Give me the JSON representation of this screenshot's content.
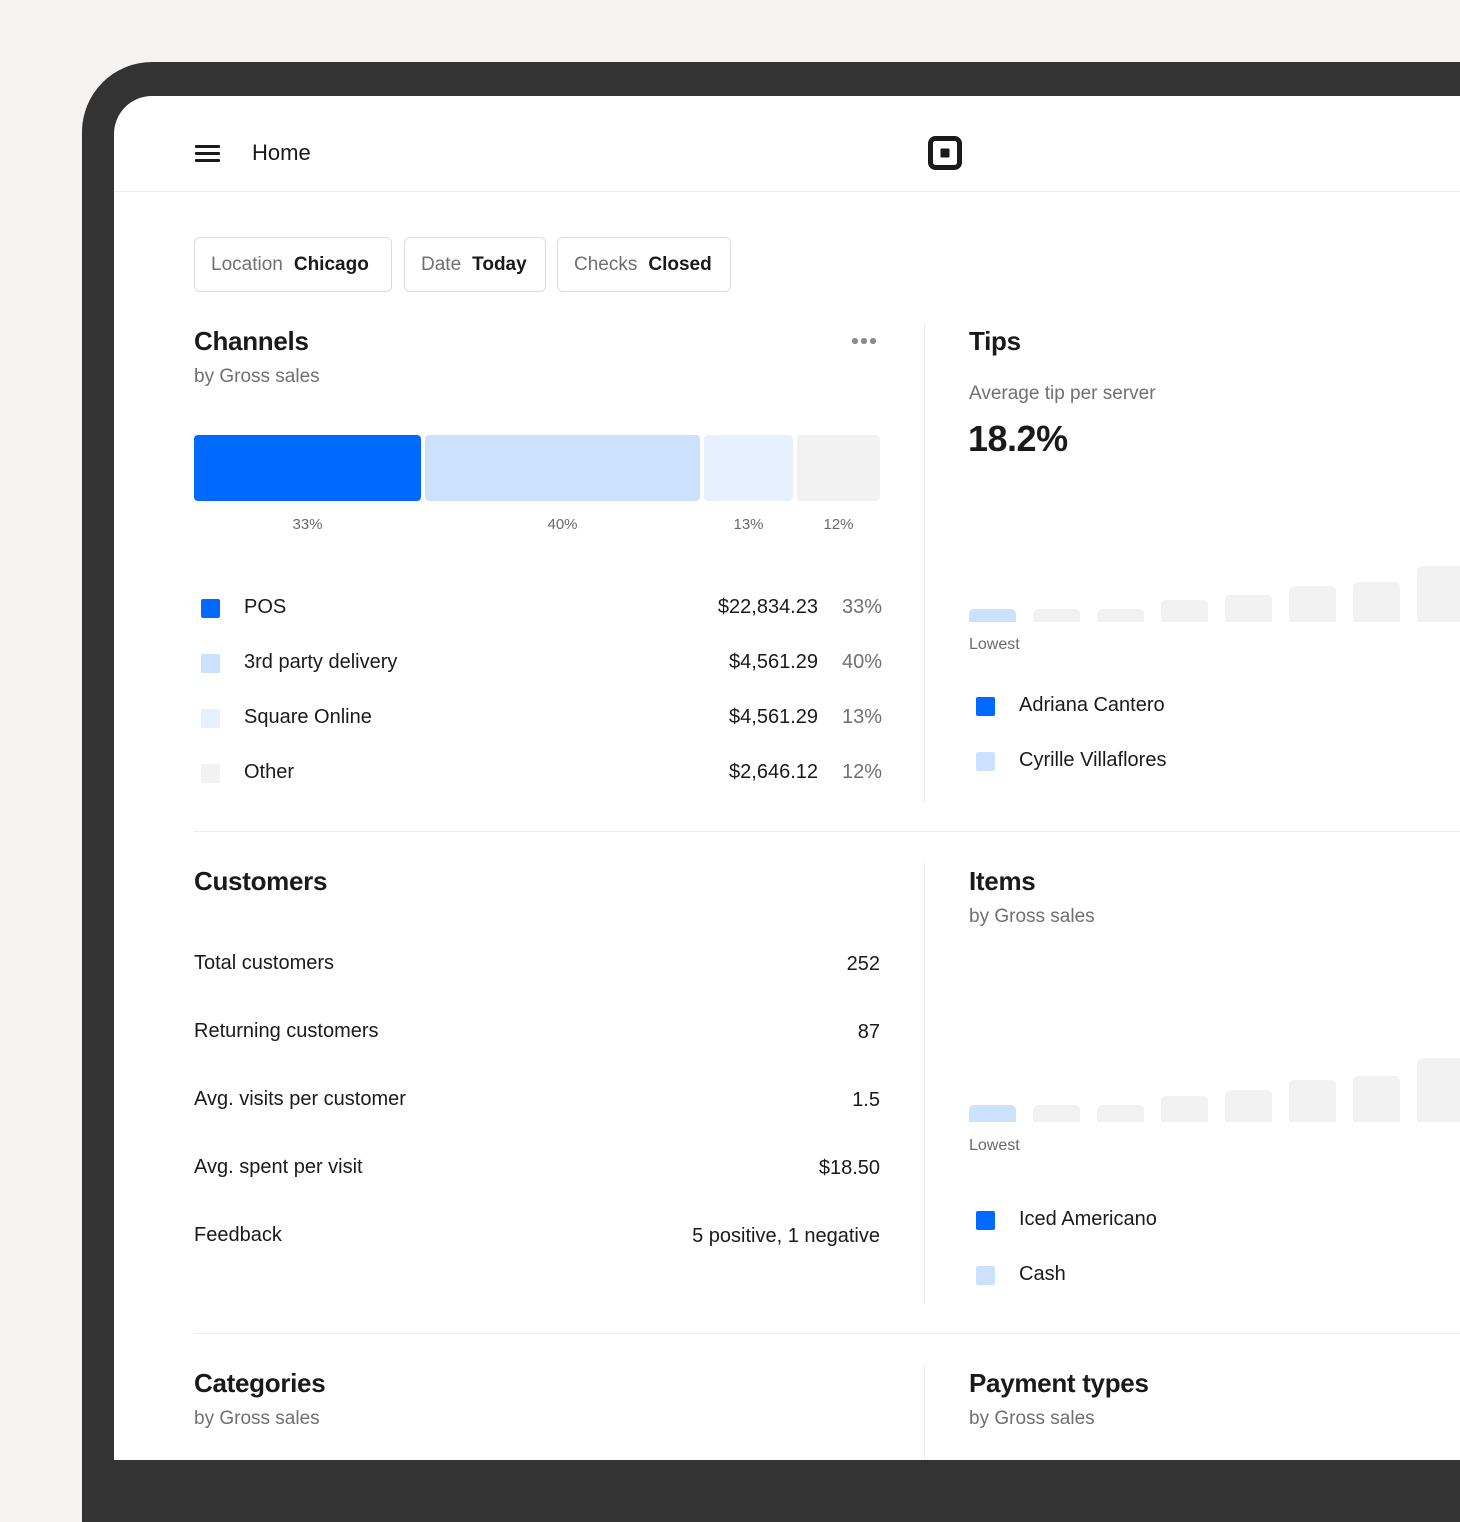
{
  "header": {
    "title": "Home",
    "menu_icon": "hamburger-icon",
    "logo": "square-logo"
  },
  "filters": [
    {
      "key": "Location",
      "value": "Chicago"
    },
    {
      "key": "Date",
      "value": "Today"
    },
    {
      "key": "Checks",
      "value": "Closed"
    }
  ],
  "colors": {
    "primary": "#006aff",
    "light": "#cce1fe",
    "lighter": "#e6f0ff",
    "neutral": "#f2f2f2"
  },
  "channels": {
    "title": "Channels",
    "subtitle": "by Gross sales",
    "bar_labels": [
      "33%",
      "40%",
      "13%",
      "12%"
    ],
    "rows": [
      {
        "label": "POS",
        "amount": "$22,834.23",
        "percent": "33%",
        "color": "#006aff"
      },
      {
        "label": "3rd party delivery",
        "amount": "$4,561.29",
        "percent": "40%",
        "color": "#cce1fe"
      },
      {
        "label": "Square Online",
        "amount": "$4,561.29",
        "percent": "13%",
        "color": "#e6f0ff"
      },
      {
        "label": "Other",
        "amount": "$2,646.12",
        "percent": "12%",
        "color": "#f2f2f2"
      }
    ]
  },
  "chart_data": [
    {
      "type": "bar",
      "title": "Channels",
      "subtitle": "by Gross sales",
      "orientation": "stacked-horizontal",
      "categories": [
        "POS",
        "3rd party delivery",
        "Square Online",
        "Other"
      ],
      "values": [
        33,
        40,
        13,
        12
      ],
      "labels": [
        "33%",
        "40%",
        "13%",
        "12%"
      ]
    },
    {
      "type": "bar",
      "title": "Tips",
      "values": [
        0.22,
        0.22,
        0.22,
        0.36,
        0.45,
        0.6,
        0.67,
        0.93
      ],
      "xlabel": "Lowest"
    },
    {
      "type": "bar",
      "title": "Items",
      "subtitle": "by Gross sales",
      "values": [
        0.26,
        0.26,
        0.26,
        0.41,
        0.5,
        0.65,
        0.72,
        1.0
      ],
      "xlabel": "Lowest"
    }
  ],
  "tips": {
    "title": "Tips",
    "subtitle": "Average tip per server",
    "value": "18.2%",
    "axis_note": "Lowest",
    "legend": [
      {
        "label": "Adriana Cantero",
        "color": "#006aff"
      },
      {
        "label": "Cyrille Villaflores",
        "color": "#cce1fe"
      }
    ]
  },
  "customers": {
    "title": "Customers",
    "rows": [
      {
        "label": "Total customers",
        "value": "252"
      },
      {
        "label": "Returning customers",
        "value": "87"
      },
      {
        "label": "Avg. visits per customer",
        "value": "1.5"
      },
      {
        "label": "Avg. spent per visit",
        "value": "$18.50"
      },
      {
        "label": "Feedback",
        "value": "5 positive, 1 negative"
      }
    ]
  },
  "items": {
    "title": "Items",
    "subtitle": "by Gross sales",
    "axis_note": "Lowest",
    "legend": [
      {
        "label": "Iced Americano",
        "color": "#006aff"
      },
      {
        "label": "Cash",
        "color": "#cce1fe"
      }
    ]
  },
  "categories": {
    "title": "Categories",
    "subtitle": "by Gross sales"
  },
  "payment_types": {
    "title": "Payment types",
    "subtitle": "by Gross sales"
  }
}
